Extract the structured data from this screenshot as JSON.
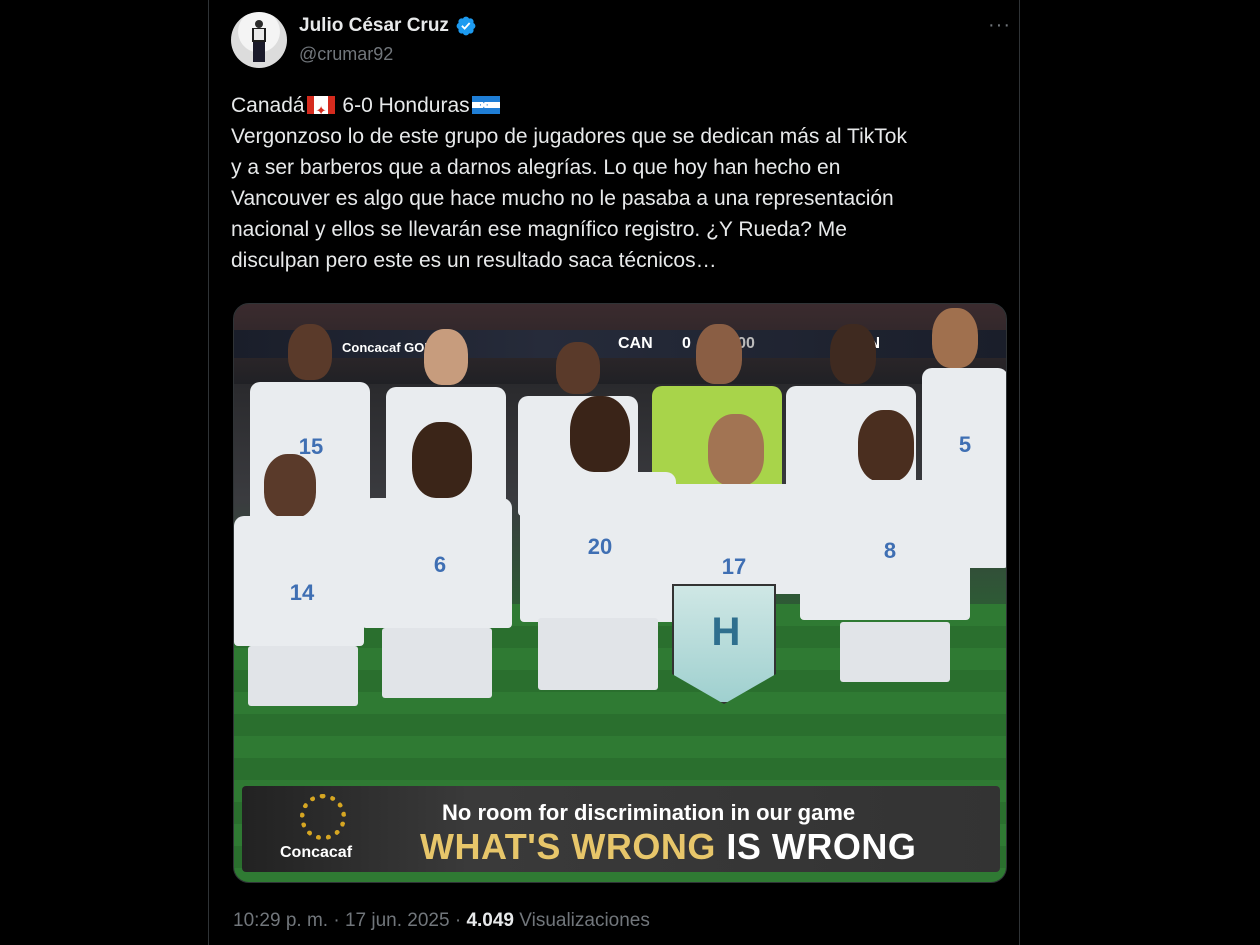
{
  "author": {
    "display_name": "Julio César Cruz",
    "handle": "@crumar92",
    "verified": true,
    "more_icon": "more-horizontal-icon"
  },
  "tweet": {
    "score_before": "Canadá",
    "score_middle": " 6-0 Honduras",
    "body": "Vergonzoso lo de este grupo de jugadores que se dedican más al TikTok\ny a ser barberos que a darnos alegrías. Lo que hoy han hecho en\nVancouver es algo que hace mucho no le pasaba a una representación\nnacional y ellos se llevarán ese magnífico registro. ¿Y Rueda? Me\ndisculpan pero este es un resultado saca técnicos…"
  },
  "media": {
    "board_left": "Concacaf GOLD",
    "board_center": "CAN",
    "board_score": "0",
    "board_clock": "00:00",
    "board_right": "ON",
    "pennant_label": "H",
    "banner_logo": "Concacaf",
    "banner_line1": "No room for discrimination in our game",
    "banner_line2_a": "WHAT'S WRONG",
    "banner_line2_b": " IS WRONG",
    "player_numbers": [
      "15",
      "",
      "",
      "",
      "",
      "5",
      "14",
      "6",
      "20",
      "17",
      "8"
    ]
  },
  "meta": {
    "time": "10:29 p. m.",
    "separator": " · ",
    "date": "17 jun. 2025",
    "views_count": "4.049",
    "views_label": " Visualizaciones"
  },
  "colors": {
    "background": "#000000",
    "text": "#e7e9ea",
    "muted": "#71767b",
    "verified": "#1d9bf0"
  }
}
